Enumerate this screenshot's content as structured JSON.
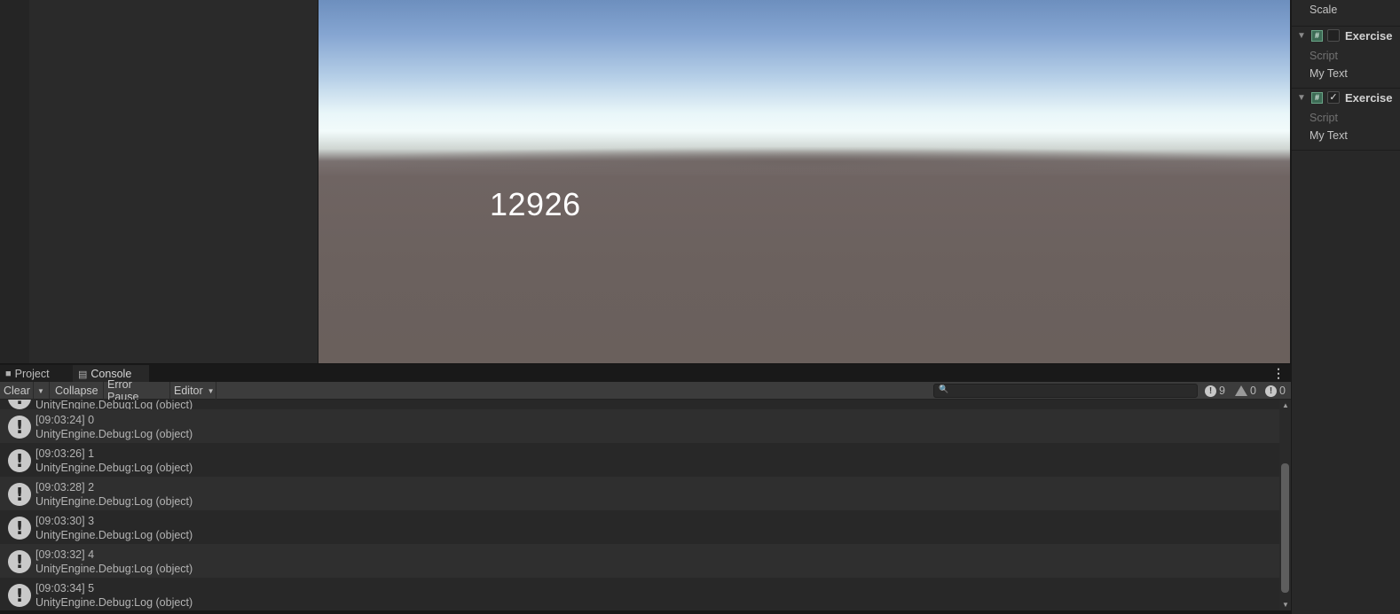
{
  "game_view": {
    "display_number": "12926"
  },
  "inspector": {
    "scale_label": "Scale",
    "components": [
      {
        "name": "Exercise",
        "enabled": false,
        "script_label": "Script",
        "my_text_label": "My Text"
      },
      {
        "name": "Exercise",
        "enabled": true,
        "script_label": "Script",
        "my_text_label": "My Text"
      }
    ]
  },
  "tabs": {
    "project": "Project",
    "console": "Console"
  },
  "console_toolbar": {
    "clear": "Clear",
    "collapse": "Collapse",
    "error_pause": "Error Pause",
    "editor": "Editor",
    "search_placeholder": "",
    "log_count": "9",
    "warning_count": "0",
    "error_count": "0"
  },
  "console_logs": {
    "partial_top": "UnityEngine.Debug:Log (object)",
    "entries": [
      {
        "message": "[09:03:24] 0",
        "stack": "UnityEngine.Debug:Log (object)"
      },
      {
        "message": "[09:03:26] 1",
        "stack": "UnityEngine.Debug:Log (object)"
      },
      {
        "message": "[09:03:28] 2",
        "stack": "UnityEngine.Debug:Log (object)"
      },
      {
        "message": "[09:03:30] 3",
        "stack": "UnityEngine.Debug:Log (object)"
      },
      {
        "message": "[09:03:32] 4",
        "stack": "UnityEngine.Debug:Log (object)"
      },
      {
        "message": "[09:03:34] 5",
        "stack": "UnityEngine.Debug:Log (object)"
      }
    ]
  }
}
